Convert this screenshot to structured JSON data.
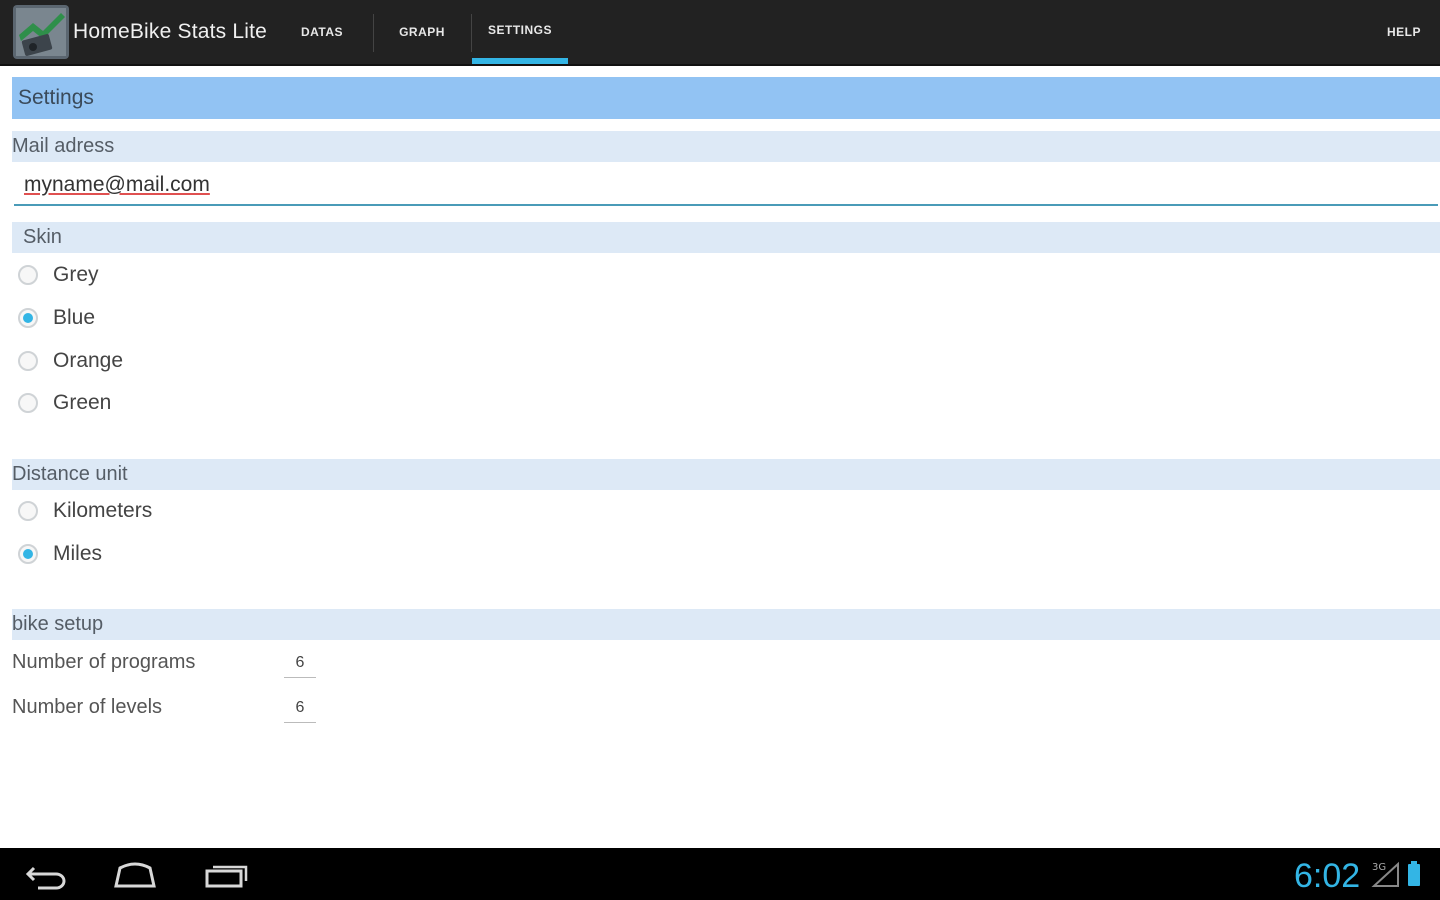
{
  "app": {
    "title": "HomeBike Stats Lite"
  },
  "tabs": [
    {
      "label": "DATAS",
      "selected": false
    },
    {
      "label": "GRAPH",
      "selected": false
    },
    {
      "label": "SETTINGS",
      "selected": true
    }
  ],
  "help_label": "HELP",
  "settings": {
    "header": "Settings",
    "mail": {
      "label": "Mail adress",
      "value": "myname@mail.com"
    },
    "skin": {
      "label": "Skin",
      "options": [
        "Grey",
        "Blue",
        "Orange",
        "Green"
      ],
      "selected": "Blue"
    },
    "distance": {
      "label": "Distance unit",
      "options": [
        "Kilometers",
        "Miles"
      ],
      "selected": "Miles"
    },
    "bike_setup": {
      "label": "bike setup",
      "programs_label": "Number of programs",
      "programs_value": "6",
      "levels_label": "Number of levels",
      "levels_value": "6"
    }
  },
  "status_bar": {
    "time": "6:02"
  },
  "colors": {
    "accent": "#33b5e5",
    "header_bg": "#92c3f3",
    "section_bg": "#dde9f6",
    "action_bar": "#222222"
  }
}
